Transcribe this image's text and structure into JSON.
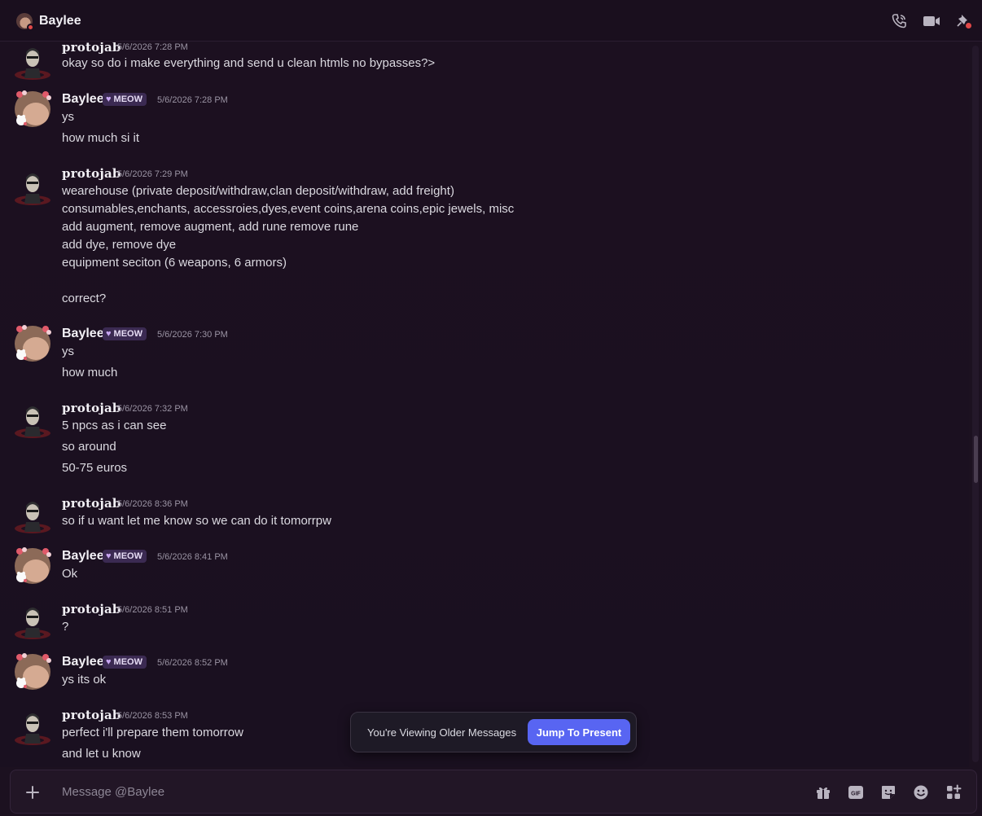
{
  "header": {
    "title": "Baylee"
  },
  "users": {
    "protojab": {
      "name": "protojab"
    },
    "baylee": {
      "name": "Baylee",
      "badge": "MEOW"
    }
  },
  "messages": [
    {
      "author": "protojab",
      "time": "5/6/2026 7:28 PM",
      "lines": [
        "okay so do i make everything and send u clean htmls no bypasses?>"
      ]
    },
    {
      "author": "Baylee",
      "badge": "MEOW",
      "time": "5/6/2026 7:28 PM",
      "lines": [
        "ys",
        "how much si it"
      ]
    },
    {
      "author": "protojab",
      "time": "5/6/2026 7:29 PM",
      "lines": [
        "wearehouse (private deposit/withdraw,clan deposit/withdraw, add freight)",
        "consumables,enchants, accessroies,dyes,event coins,arena coins,epic jewels, misc",
        "add augment, remove augment, add rune remove rune",
        "add dye, remove dye",
        "equipment seciton (6 weapons, 6 armors)",
        "",
        "correct?"
      ]
    },
    {
      "author": "Baylee",
      "badge": "MEOW",
      "time": "5/6/2026 7:30 PM",
      "lines": [
        "ys",
        "how much"
      ]
    },
    {
      "author": "protojab",
      "time": "5/6/2026 7:32 PM",
      "lines": [
        "5 npcs as i can see",
        "so around",
        "50-75 euros"
      ]
    },
    {
      "author": "protojab",
      "time": "5/6/2026 8:36 PM",
      "lines": [
        "so if u want let me know so we can do it tomorrpw"
      ]
    },
    {
      "author": "Baylee",
      "badge": "MEOW",
      "time": "5/6/2026 8:41 PM",
      "lines": [
        "Ok"
      ]
    },
    {
      "author": "protojab",
      "time": "5/6/2026 8:51 PM",
      "lines": [
        "?"
      ]
    },
    {
      "author": "Baylee",
      "badge": "MEOW",
      "time": "5/6/2026 8:52 PM",
      "lines": [
        "ys its ok"
      ]
    },
    {
      "author": "protojab",
      "time": "5/6/2026 8:53 PM",
      "lines": [
        "perfect i'll prepare them tomorrow",
        "and let u know"
      ]
    }
  ],
  "older_notice": {
    "text": "You're Viewing Older Messages",
    "button": "Jump To Present"
  },
  "composer": {
    "placeholder": "Message @Baylee"
  },
  "icons": {
    "header": [
      "phone-call-icon",
      "video-call-icon",
      "pin-icon"
    ],
    "composer": [
      "plus-icon",
      "gift-icon",
      "gif-icon",
      "sticker-icon",
      "emoji-icon",
      "apps-icon"
    ]
  },
  "colors": {
    "accent": "#5865f2",
    "background": "#1c1120",
    "badge": "#3b2a52",
    "status": "#e04848"
  }
}
